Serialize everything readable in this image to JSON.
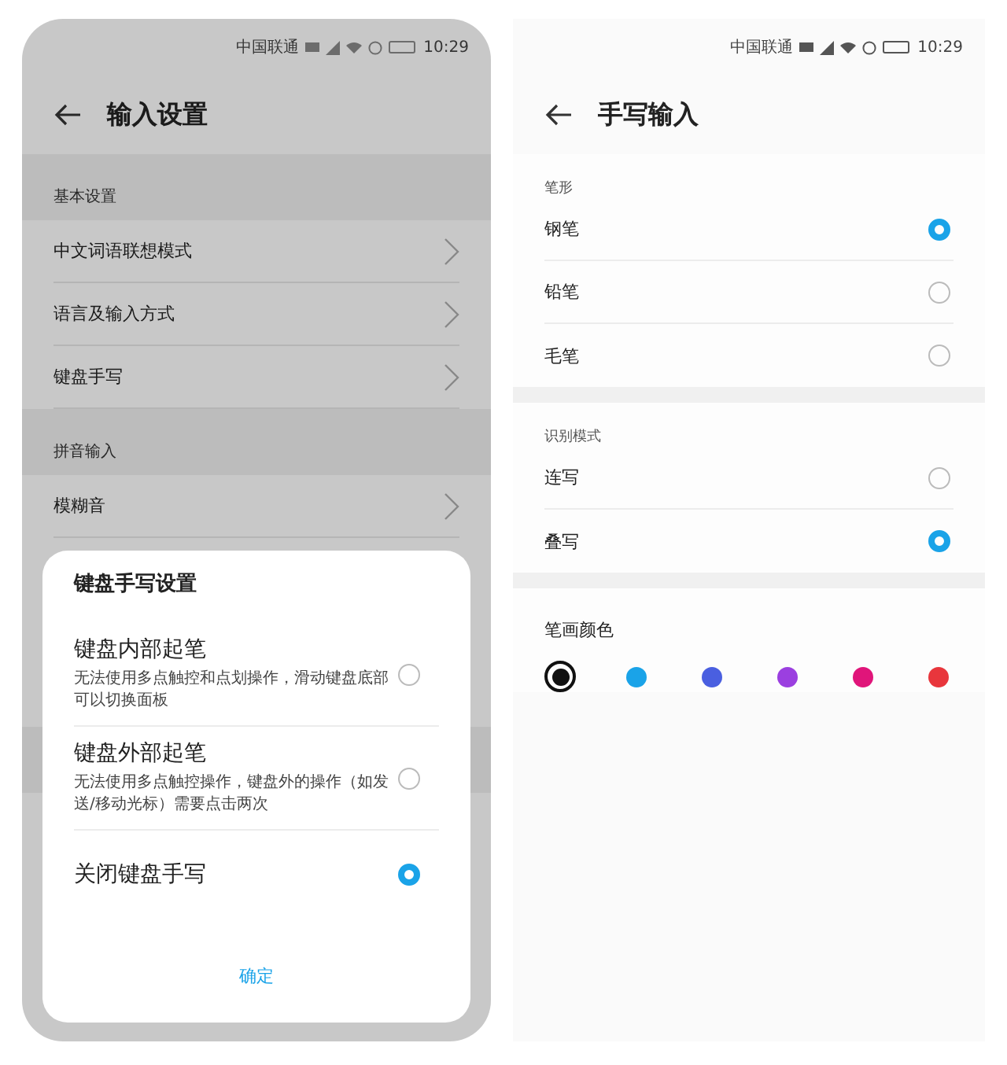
{
  "left_screen": {
    "status_bar": {
      "carrier": "中国联通",
      "time": "10:29"
    },
    "title": "输入设置",
    "sections": [
      {
        "header": "基本设置",
        "items": [
          {
            "label": "中文词语联想模式"
          },
          {
            "label": "语言及输入方式"
          },
          {
            "label": "键盘手写"
          }
        ]
      },
      {
        "header": "拼音输入",
        "items": [
          {
            "label": "模糊音"
          }
        ]
      }
    ],
    "dialog": {
      "title": "键盘手写设置",
      "options": [
        {
          "label": "键盘内部起笔",
          "description": "无法使用多点触控和点划操作，滑动键盘底部可以切换面板",
          "selected": false
        },
        {
          "label": "键盘外部起笔",
          "description": "无法使用多点触控操作，键盘外的操作（如发送/移动光标）需要点击两次",
          "selected": false
        },
        {
          "label": "关闭键盘手写",
          "selected": true
        }
      ],
      "confirm": "确定"
    }
  },
  "right_screen": {
    "status_bar": {
      "carrier": "中国联通",
      "time": "10:29"
    },
    "title": "手写输入",
    "groups": [
      {
        "header": "笔形",
        "options": [
          {
            "label": "钢笔",
            "selected": true
          },
          {
            "label": "铅笔",
            "selected": false
          },
          {
            "label": "毛笔",
            "selected": false
          }
        ]
      },
      {
        "header": "识别模式",
        "options": [
          {
            "label": "连写",
            "selected": false
          },
          {
            "label": "叠写",
            "selected": true
          }
        ]
      }
    ],
    "color_section": {
      "header": "笔画颜色",
      "colors": [
        {
          "color": "#111111",
          "selected": true
        },
        {
          "color": "#1aa3e8",
          "selected": false
        },
        {
          "color": "#4a5fe0",
          "selected": false
        },
        {
          "color": "#9b3fe0",
          "selected": false
        },
        {
          "color": "#e0157a",
          "selected": false
        },
        {
          "color": "#e8363c",
          "selected": false
        }
      ]
    }
  }
}
